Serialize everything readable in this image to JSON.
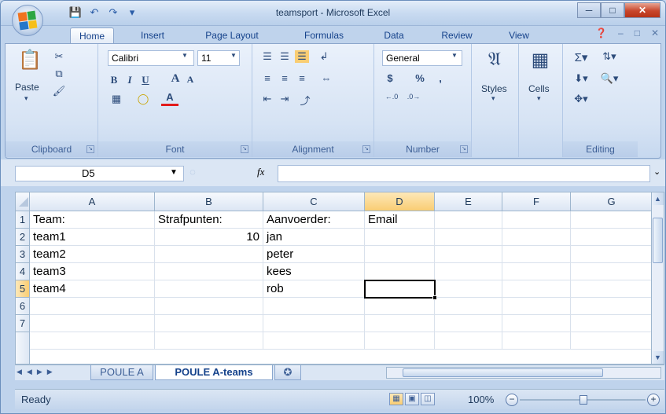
{
  "window": {
    "title": "teamsport - Microsoft Excel"
  },
  "tabs": [
    "Home",
    "Insert",
    "Page Layout",
    "Formulas",
    "Data",
    "Review",
    "View"
  ],
  "ribbon": {
    "clipboard": {
      "label": "Clipboard",
      "paste": "Paste"
    },
    "font": {
      "label": "Font",
      "name": "Calibri",
      "size": "11",
      "bold": "B",
      "italic": "I",
      "underline": "U",
      "grow": "A",
      "shrink": "A"
    },
    "alignment": {
      "label": "Alignment"
    },
    "number": {
      "label": "Number",
      "format": "General",
      "currency": "$",
      "percent": "%",
      "comma": ","
    },
    "styles": {
      "label": "Styles"
    },
    "cells": {
      "label": "Cells"
    },
    "editing": {
      "label": "Editing"
    }
  },
  "formula_bar": {
    "name_box": "D5",
    "fx": "fx",
    "value": ""
  },
  "sheet": {
    "columns": [
      "A",
      "B",
      "C",
      "D",
      "E",
      "F",
      "G"
    ],
    "rows": [
      "1",
      "2",
      "3",
      "4",
      "5",
      "6",
      "7"
    ],
    "cells": {
      "A1": "Team:",
      "B1": "Strafpunten:",
      "C1": "Aanvoerder:",
      "D1": "Email",
      "A2": "team1",
      "B2": "10",
      "C2": "jan",
      "A3": "team2",
      "C3": "peter",
      "A4": "team3",
      "C4": "kees",
      "A5": "team4",
      "C5": "rob"
    },
    "active_cell": "D5"
  },
  "sheet_tabs": [
    "POULE A",
    "POULE A-teams"
  ],
  "active_sheet": "POULE A-teams",
  "status": {
    "text": "Ready",
    "zoom": "100%"
  },
  "colors": {
    "accent": "#15428b",
    "selected_header": "#f9cd73"
  }
}
